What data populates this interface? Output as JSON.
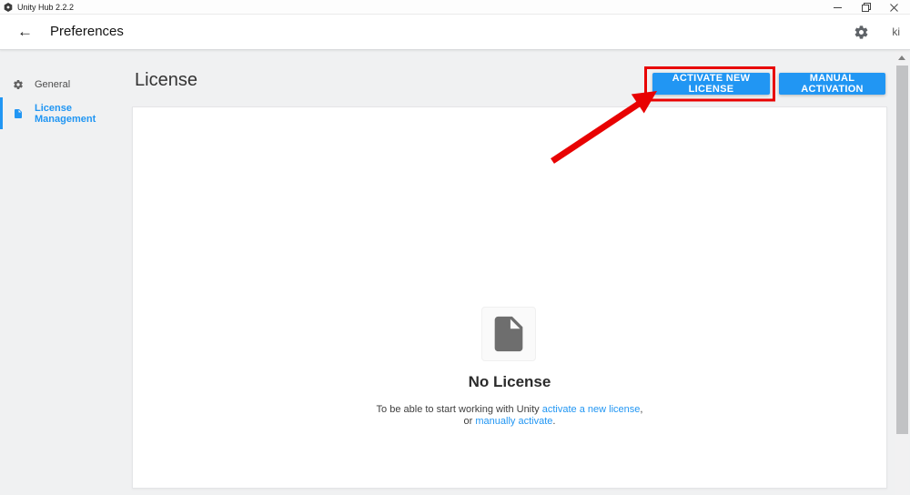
{
  "titlebar": {
    "title": "Unity Hub 2.2.2"
  },
  "header": {
    "back_glyph": "←",
    "title": "Preferences",
    "user": "ki"
  },
  "sidebar": {
    "items": [
      {
        "label": "General",
        "icon": "gear-icon",
        "active": false
      },
      {
        "label": "License Management",
        "icon": "file-icon",
        "active": true
      }
    ]
  },
  "page": {
    "title": "License",
    "actions": [
      {
        "label": "ACTIVATE NEW LICENSE",
        "highlighted": true
      },
      {
        "label": "MANUAL ACTIVATION",
        "highlighted": false
      }
    ]
  },
  "empty_state": {
    "title": "No License",
    "line1_prefix": "To be able to start working with Unity ",
    "line1_link": "activate a new license",
    "line1_suffix": ",",
    "line2_prefix": "or ",
    "line2_link": "manually activate",
    "line2_suffix": "."
  },
  "colors": {
    "accent_blue": "#2196f3",
    "link_blue": "#2196f3",
    "sidebar_active_blue": "#2196f3",
    "annotation_red": "#e80202",
    "content_background": "#f0f1f2",
    "file_icon_gray": "#6e6e6e"
  }
}
